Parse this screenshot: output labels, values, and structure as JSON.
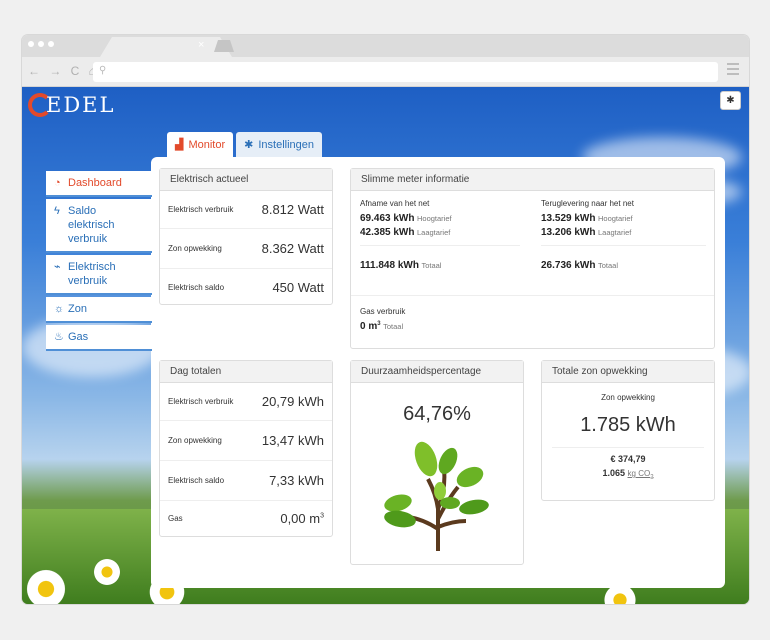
{
  "browser": {
    "tab_close": "×",
    "nav_glyphs": "← → C ⌂",
    "search_glyph": "⚲"
  },
  "logo": {
    "text": "EDEL"
  },
  "tabs": [
    {
      "label": "Monitor",
      "icon": "chart-icon",
      "glyph": "▟"
    },
    {
      "label": "Instellingen",
      "icon": "gear-icon",
      "glyph": "✱"
    }
  ],
  "settings_glyph": "✱",
  "sidebar": {
    "items": [
      {
        "label": "Dashboard",
        "icon": "dashboard-icon",
        "glyph": "◔"
      },
      {
        "label": "Saldo elektrisch verbruik",
        "icon": "bolt-icon",
        "glyph": "ϟ"
      },
      {
        "label": "Elektrisch verbruik",
        "icon": "plug-icon",
        "glyph": "⌁"
      },
      {
        "label": "Zon",
        "icon": "sun-icon",
        "glyph": "☼"
      },
      {
        "label": "Gas",
        "icon": "flame-icon",
        "glyph": "♨"
      }
    ]
  },
  "elektrisch_actueel": {
    "title": "Elektrisch actueel",
    "rows": [
      {
        "label": "Elektrisch verbruik",
        "value": "8.812 Watt"
      },
      {
        "label": "Zon opwekking",
        "value": "8.362 Watt"
      },
      {
        "label": "Elektrisch saldo",
        "value": "450 Watt"
      }
    ]
  },
  "slimme_meter": {
    "title": "Slimme meter informatie",
    "afname": {
      "header": "Afname van het net",
      "hoog_value": "69.463 kWh",
      "hoog_label": "Hoogtarief",
      "laag_value": "42.385 kWh",
      "laag_label": "Laagtarief",
      "totaal_value": "111.848 kWh",
      "totaal_label": "Totaal"
    },
    "teruglevering": {
      "header": "Teruglevering naar het net",
      "hoog_value": "13.529 kWh",
      "hoog_label": "Hoogtarief",
      "laag_value": "13.206 kWh",
      "laag_label": "Laagtarief",
      "totaal_value": "26.736 kWh",
      "totaal_label": "Totaal"
    },
    "gas": {
      "header": "Gas verbruik",
      "value": "0 m",
      "sup": "3",
      "label": "Totaal"
    }
  },
  "dag_totalen": {
    "title": "Dag totalen",
    "rows": [
      {
        "label": "Elektrisch verbruik",
        "value": "20,79 kWh"
      },
      {
        "label": "Zon opwekking",
        "value": "13,47 kWh"
      },
      {
        "label": "Elektrisch saldo",
        "value": "7,33 kWh"
      },
      {
        "label": "Gas",
        "value": "0,00 m",
        "sup": "3"
      }
    ]
  },
  "duurzaamheid": {
    "title": "Duurzaamheidspercentage",
    "value": "64,76%"
  },
  "zon_opwekking": {
    "title": "Totale zon opwekking",
    "label": "Zon opwekking",
    "value": "1.785 kWh",
    "euro": "€ 374,79",
    "co2_value": "1.065",
    "co2_unit": "kg CO",
    "co2_sub": "2"
  }
}
